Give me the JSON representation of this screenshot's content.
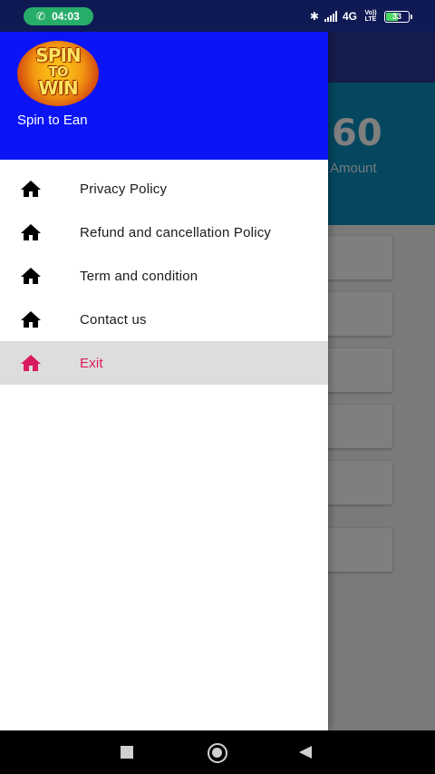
{
  "status_bar": {
    "time": "04:03",
    "network": "4G",
    "carrier_tag": "Vo)) LTE",
    "battery": "33"
  },
  "background": {
    "amount_value": "60",
    "amount_label": "Amount"
  },
  "drawer": {
    "logo_text": [
      "SPIN",
      "TO",
      "WIN"
    ],
    "app_name": "Spin to Ean",
    "items": [
      {
        "label": "Privacy Policy",
        "icon": "home-icon"
      },
      {
        "label": "Refund and cancellation Policy",
        "icon": "home-icon"
      },
      {
        "label": "Term and condition",
        "icon": "home-icon"
      },
      {
        "label": "Contact us",
        "icon": "home-icon"
      },
      {
        "label": "Exit",
        "icon": "home-icon",
        "active": true
      }
    ],
    "colors": {
      "header": "#0a14f5",
      "active_text": "#d81b60",
      "active_bg": "#dddddd"
    }
  },
  "nav_bar": {
    "buttons": [
      "recents",
      "home",
      "back"
    ]
  }
}
